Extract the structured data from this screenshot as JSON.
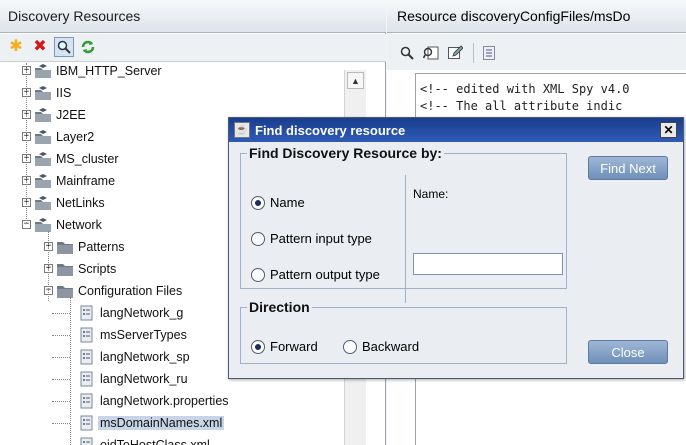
{
  "left_panel": {
    "title": "Discovery Resources",
    "toolbar": [
      {
        "icon": "asterisk-new-icon",
        "glyph": "✱",
        "color": "#f2b01e"
      },
      {
        "icon": "red-x-delete-icon",
        "glyph": "✖",
        "color": "#d11b1b"
      },
      {
        "icon": "magnifier-find-icon",
        "glyph": "🔍",
        "color": "#333333"
      },
      {
        "icon": "green-refresh-icon",
        "glyph": "⟳",
        "color": "#2f9e2f"
      }
    ],
    "tree": [
      {
        "label": "IBM_HTTP_Server",
        "type": "package",
        "expander": "+"
      },
      {
        "label": "IIS",
        "type": "package",
        "expander": "+"
      },
      {
        "label": "J2EE",
        "type": "package",
        "expander": "+"
      },
      {
        "label": "Layer2",
        "type": "package",
        "expander": "+"
      },
      {
        "label": "MS_cluster",
        "type": "package",
        "expander": "+"
      },
      {
        "label": "Mainframe",
        "type": "package",
        "expander": "+"
      },
      {
        "label": "NetLinks",
        "type": "package",
        "expander": "+"
      },
      {
        "label": "Network",
        "type": "package",
        "expander": "−"
      },
      {
        "label": "Patterns",
        "type": "folder",
        "expander": "+"
      },
      {
        "label": "Scripts",
        "type": "folder",
        "expander": "+"
      },
      {
        "label": "Configuration Files",
        "type": "folder",
        "expander": "−"
      },
      {
        "label": "langNetwork_g",
        "type": "file"
      },
      {
        "label": "msServerTypes",
        "type": "file"
      },
      {
        "label": "langNetwork_sp",
        "type": "file"
      },
      {
        "label": "langNetwork_ru",
        "type": "file"
      },
      {
        "label": "langNetwork.properties",
        "type": "file"
      },
      {
        "label": "msDomainNames.xml",
        "type": "file",
        "selected": true
      },
      {
        "label": "oidToHostClass.xml",
        "type": "file"
      }
    ]
  },
  "right_panel": {
    "title": "Resource discoveryConfigFiles/msDo",
    "xml_lines": [
      "<!-- edited with XML Spy v4.0",
      "<!-- The all attribute indic"
    ]
  },
  "dialog": {
    "title": "Find discovery resource",
    "find_group_label": "Find Discovery Resource by:",
    "options": [
      {
        "label": "Name",
        "checked": true
      },
      {
        "label": "Pattern input type",
        "checked": false
      },
      {
        "label": "Pattern output type",
        "checked": false
      }
    ],
    "name_label": "Name:",
    "name_value": "",
    "direction_label": "Direction",
    "directions": [
      {
        "label": "Forward",
        "checked": true
      },
      {
        "label": "Backward",
        "checked": false
      }
    ],
    "find_next_label": "Find Next",
    "close_label": "Close",
    "close_glyph": "✕"
  }
}
